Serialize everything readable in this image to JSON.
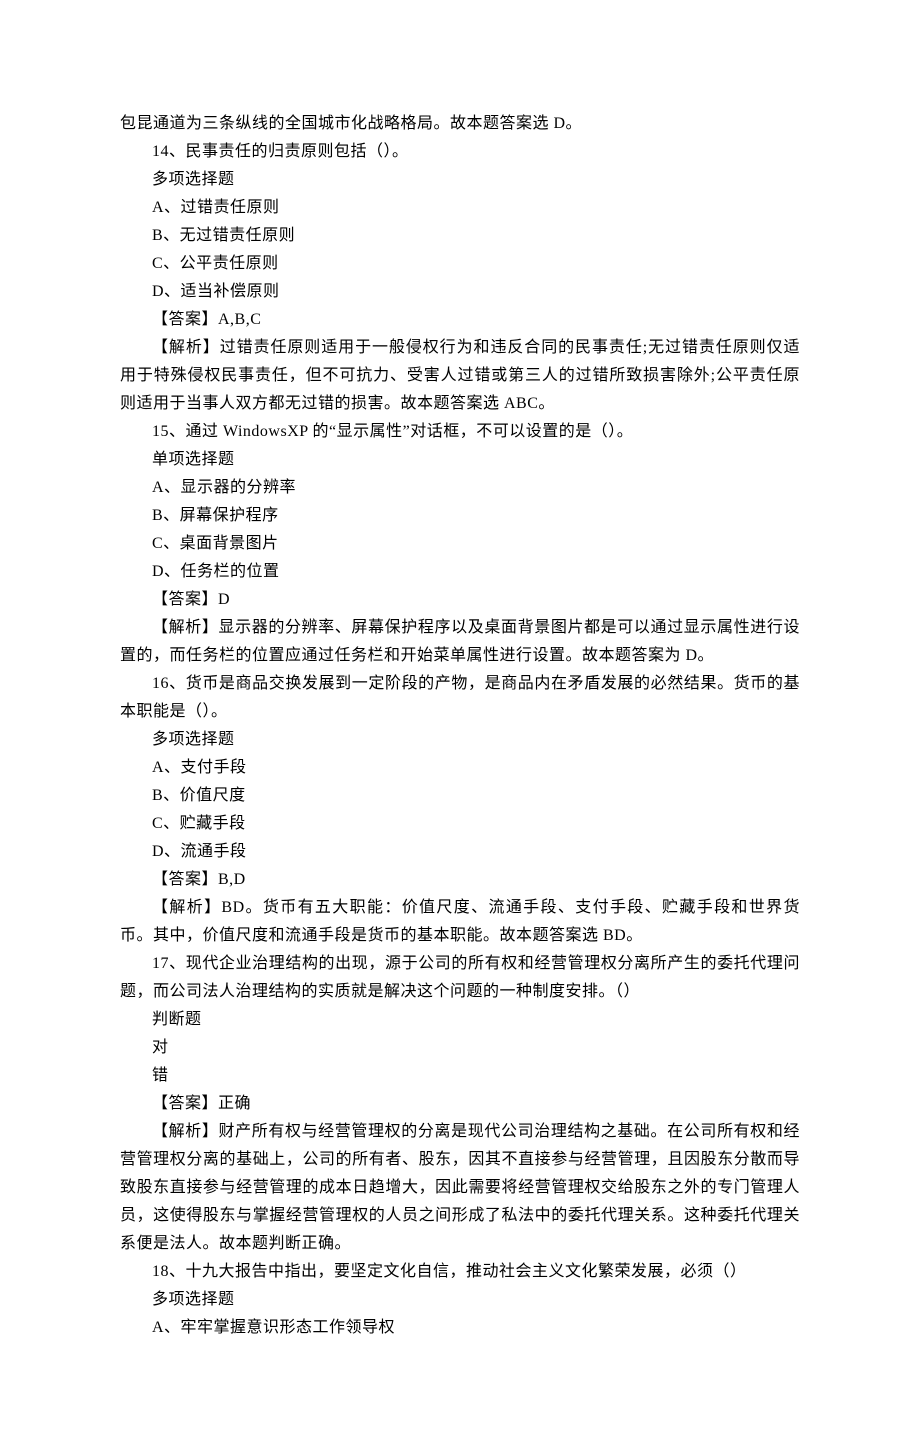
{
  "lines": {
    "l0": "包昆通道为三条纵线的全国城市化战略格局。故本题答案选 D。",
    "l1": "14、民事责任的归责原则包括（）。",
    "l2": "多项选择题",
    "l3": "A、过错责任原则",
    "l4": "B、无过错责任原则",
    "l5": "C、公平责任原则",
    "l6": "D、适当补偿原则",
    "l7": "【答案】A,B,C",
    "l8": "【解析】过错责任原则适用于一般侵权行为和违反合同的民事责任;无过错责任原则仅适用于特殊侵权民事责任，但不可抗力、受害人过错或第三人的过错所致损害除外;公平责任原则适用于当事人双方都无过错的损害。故本题答案选 ABC。",
    "l9": "15、通过 WindowsXP 的“显示属性”对话框，不可以设置的是（）。",
    "l10": "单项选择题",
    "l11": "A、显示器的分辨率",
    "l12": "B、屏幕保护程序",
    "l13": "C、桌面背景图片",
    "l14": "D、任务栏的位置",
    "l15": "【答案】D",
    "l16": "【解析】显示器的分辨率、屏幕保护程序以及桌面背景图片都是可以通过显示属性进行设置的，而任务栏的位置应通过任务栏和开始菜单属性进行设置。故本题答案为 D。",
    "l17": "16、货币是商品交换发展到一定阶段的产物，是商品内在矛盾发展的必然结果。货币的基本职能是（）。",
    "l18": "多项选择题",
    "l19": "A、支付手段",
    "l20": "B、价值尺度",
    "l21": "C、贮藏手段",
    "l22": "D、流通手段",
    "l23": "【答案】B,D",
    "l24": "【解析】BD。货币有五大职能：价值尺度、流通手段、支付手段、贮藏手段和世界货币。其中，价值尺度和流通手段是货币的基本职能。故本题答案选 BD。",
    "l25": "17、现代企业治理结构的出现，源于公司的所有权和经营管理权分离所产生的委托代理问题，而公司法人治理结构的实质就是解决这个问题的一种制度安排。（）",
    "l26": "判断题",
    "l27": "对",
    "l28": "错",
    "l29": "【答案】正确",
    "l30": "【解析】财产所有权与经营管理权的分离是现代公司治理结构之基础。在公司所有权和经营管理权分离的基础上，公司的所有者、股东，因其不直接参与经营管理，且因股东分散而导致股东直接参与经营管理的成本日趋增大，因此需要将经营管理权交给股东之外的专门管理人员，这使得股东与掌握经营管理权的人员之间形成了私法中的委托代理关系。这种委托代理关系便是法人。故本题判断正确。",
    "l31": "18、十九大报告中指出，要坚定文化自信，推动社会主义文化繁荣发展，必须（）",
    "l32": "多项选择题",
    "l33": "A、牢牢掌握意识形态工作领导权"
  }
}
